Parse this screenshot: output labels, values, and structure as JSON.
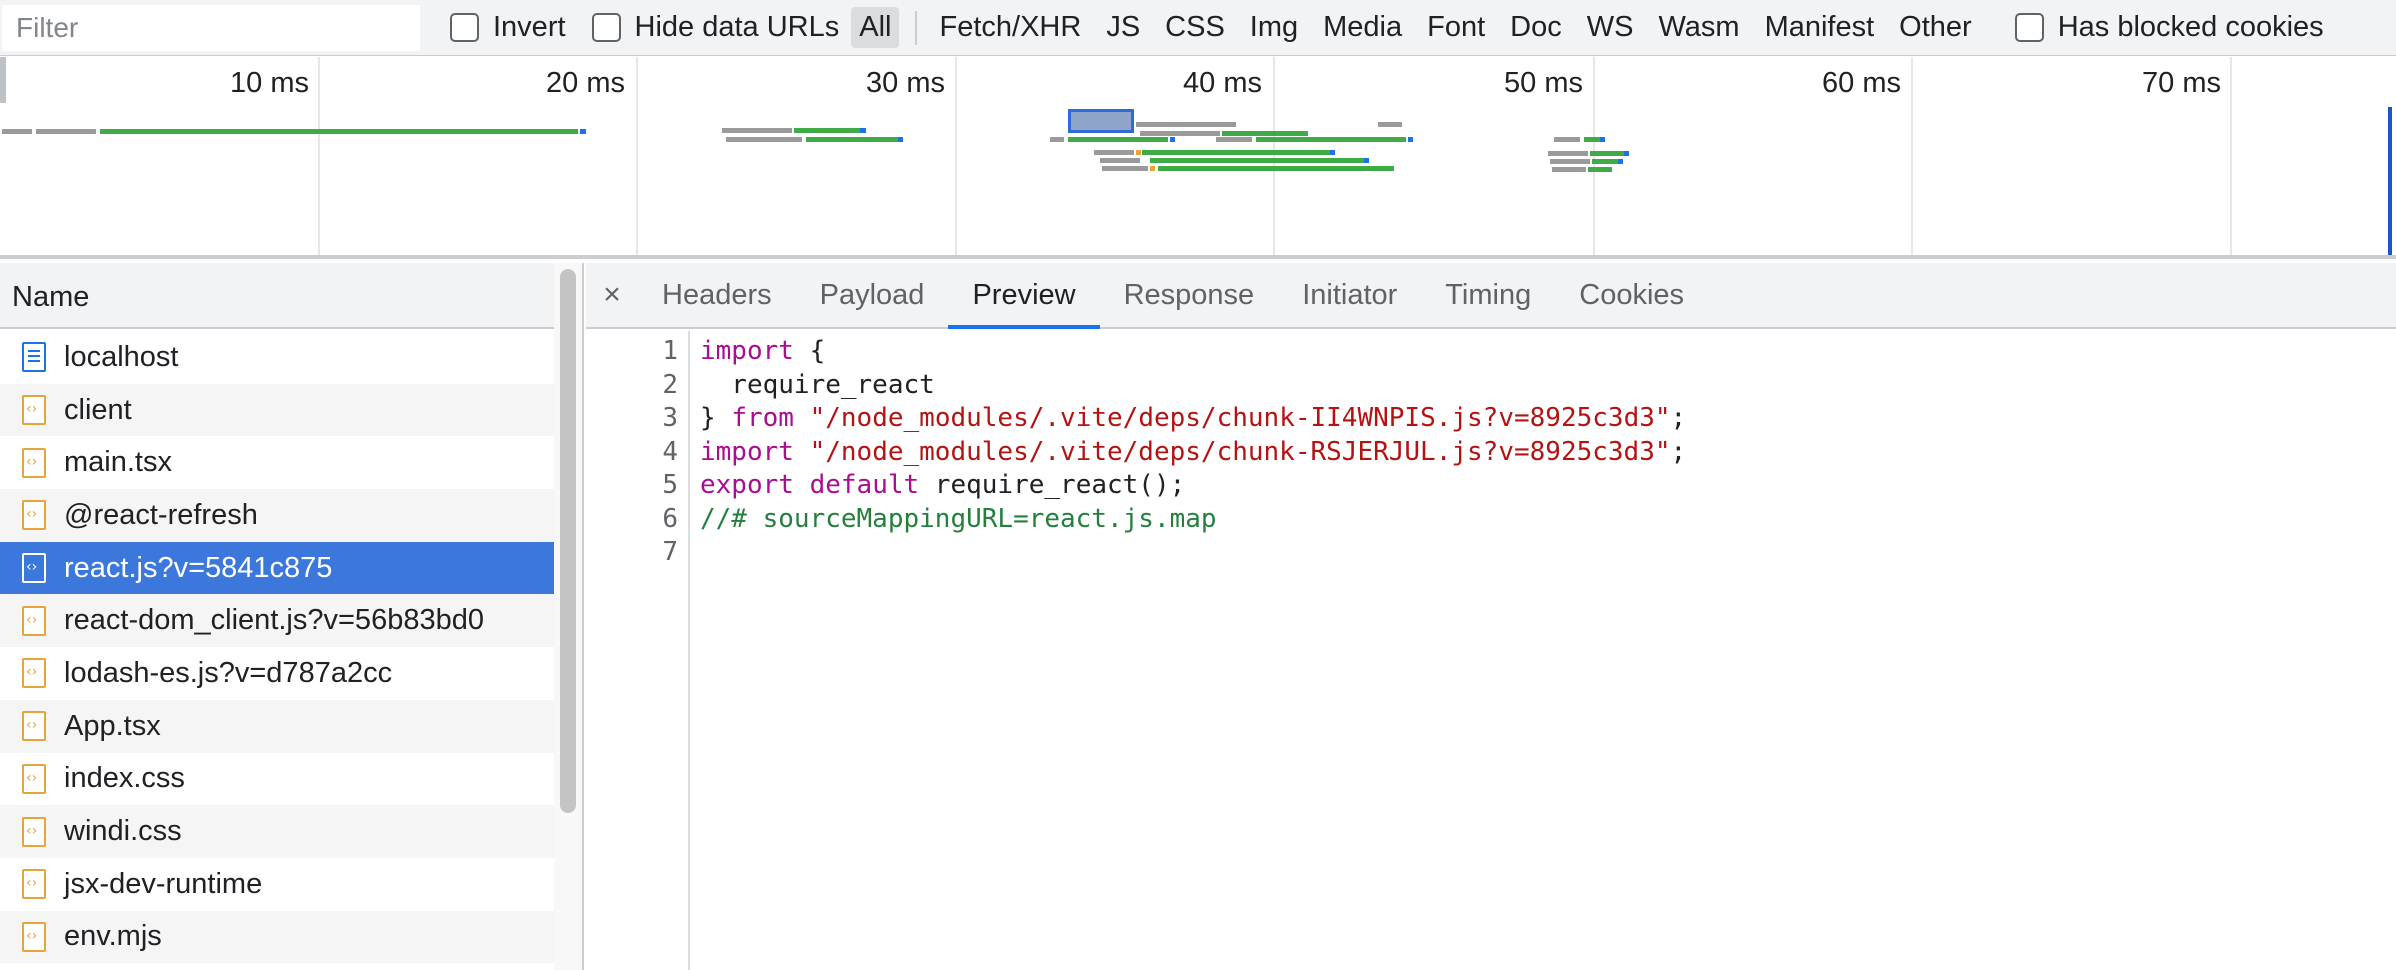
{
  "filter": {
    "placeholder": "Filter"
  },
  "checkboxes": {
    "invert": "Invert",
    "hide_data_urls": "Hide data URLs",
    "has_blocked_cookies": "Has blocked cookies"
  },
  "types": [
    "All",
    "Fetch/XHR",
    "JS",
    "CSS",
    "Img",
    "Media",
    "Font",
    "Doc",
    "WS",
    "Wasm",
    "Manifest",
    "Other"
  ],
  "active_type": "All",
  "overview": {
    "ticks": [
      "10 ms",
      "20 ms",
      "30 ms",
      "40 ms",
      "50 ms",
      "60 ms",
      "70 ms"
    ],
    "colors": {
      "waiting": "#9a9a9a",
      "download": "#3fab46",
      "receive": "#1a73e8",
      "queued": "#e8a33a"
    }
  },
  "request_list": {
    "header": "Name",
    "selected_index": 4,
    "rows": [
      {
        "name": "localhost",
        "icon": "document-icon"
      },
      {
        "name": "client",
        "icon": "script-icon"
      },
      {
        "name": "main.tsx",
        "icon": "script-icon"
      },
      {
        "name": "@react-refresh",
        "icon": "script-icon"
      },
      {
        "name": "react.js?v=5841c875",
        "icon": "script-icon"
      },
      {
        "name": "react-dom_client.js?v=56b83bd0",
        "icon": "script-icon"
      },
      {
        "name": "lodash-es.js?v=d787a2cc",
        "icon": "script-icon"
      },
      {
        "name": "App.tsx",
        "icon": "script-icon"
      },
      {
        "name": "index.css",
        "icon": "script-icon"
      },
      {
        "name": "windi.css",
        "icon": "script-icon"
      },
      {
        "name": "jsx-dev-runtime",
        "icon": "script-icon"
      },
      {
        "name": "env.mjs",
        "icon": "script-icon"
      }
    ]
  },
  "detail": {
    "close_icon": "×",
    "tabs": [
      "Headers",
      "Payload",
      "Preview",
      "Response",
      "Initiator",
      "Timing",
      "Cookies"
    ],
    "active_tab": "Preview",
    "line_numbers": [
      "1",
      "2",
      "3",
      "4",
      "5",
      "6",
      "7"
    ],
    "code": {
      "l1_kw": "import",
      "l1_rest": " {",
      "l2": "  require_react",
      "l3_a": "} ",
      "l3_kw": "from",
      "l3_sp": " ",
      "l3_str": "\"/node_modules/.vite/deps/chunk-II4WNPIS.js?v=8925c3d3\"",
      "l3_end": ";",
      "l4_kw": "import",
      "l4_sp": " ",
      "l4_str": "\"/node_modules/.vite/deps/chunk-RSJERJUL.js?v=8925c3d3\"",
      "l4_end": ";",
      "l5_kw1": "export",
      "l5_sp": " ",
      "l5_kw2": "default",
      "l5_rest": " require_react();",
      "l6_cm": "//# sourceMappingURL=react.js.map",
      "l7": ""
    }
  }
}
